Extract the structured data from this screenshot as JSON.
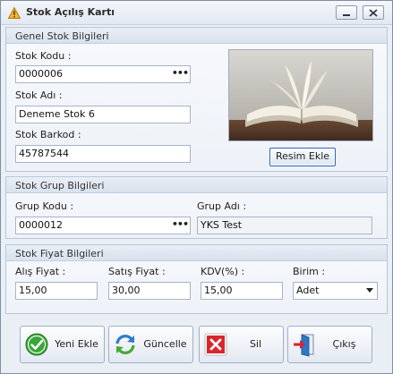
{
  "window": {
    "title": "Stok Açılış Kartı"
  },
  "general": {
    "header": "Genel Stok Bilgileri",
    "stok_kodu_label": "Stok Kodu :",
    "stok_kodu_value": "0000006",
    "stok_adi_label": "Stok Adı :",
    "stok_adi_value": "Deneme Stok 6",
    "stok_barkod_label": "Stok Barkod :",
    "stok_barkod_value": "45787544",
    "lookup_glyph": "•••",
    "image_button_label": "Resim Ekle"
  },
  "group": {
    "header": "Stok Grup Bilgileri",
    "grup_kodu_label": "Grup Kodu :",
    "grup_kodu_value": "0000012",
    "grup_adi_label": "Grup Adı :",
    "grup_adi_value": "YKS Test"
  },
  "price": {
    "header": "Stok Fiyat Bilgileri",
    "alis_label": "Alış Fiyat :",
    "alis_value": "15,00",
    "satis_label": "Satış Fiyat :",
    "satis_value": "30,00",
    "kdv_label": "KDV(%) :",
    "kdv_value": "15,00",
    "birim_label": "Birim :",
    "birim_value": "Adet"
  },
  "actions": {
    "yeni_ekle": "Yeni Ekle",
    "guncelle": "Güncelle",
    "sil": "Sil",
    "cikis": "Çıkış"
  },
  "icons": {
    "app": "warning-triangle-icon",
    "yeni_ekle": "check-circle-icon",
    "guncelle": "refresh-arrows-icon",
    "sil": "delete-x-icon",
    "cikis": "exit-door-icon"
  },
  "colors": {
    "accent": "#2f66b8",
    "check_green": "#3aa53a",
    "delete_red": "#d9252b",
    "exit_blue": "#2c78c8"
  }
}
